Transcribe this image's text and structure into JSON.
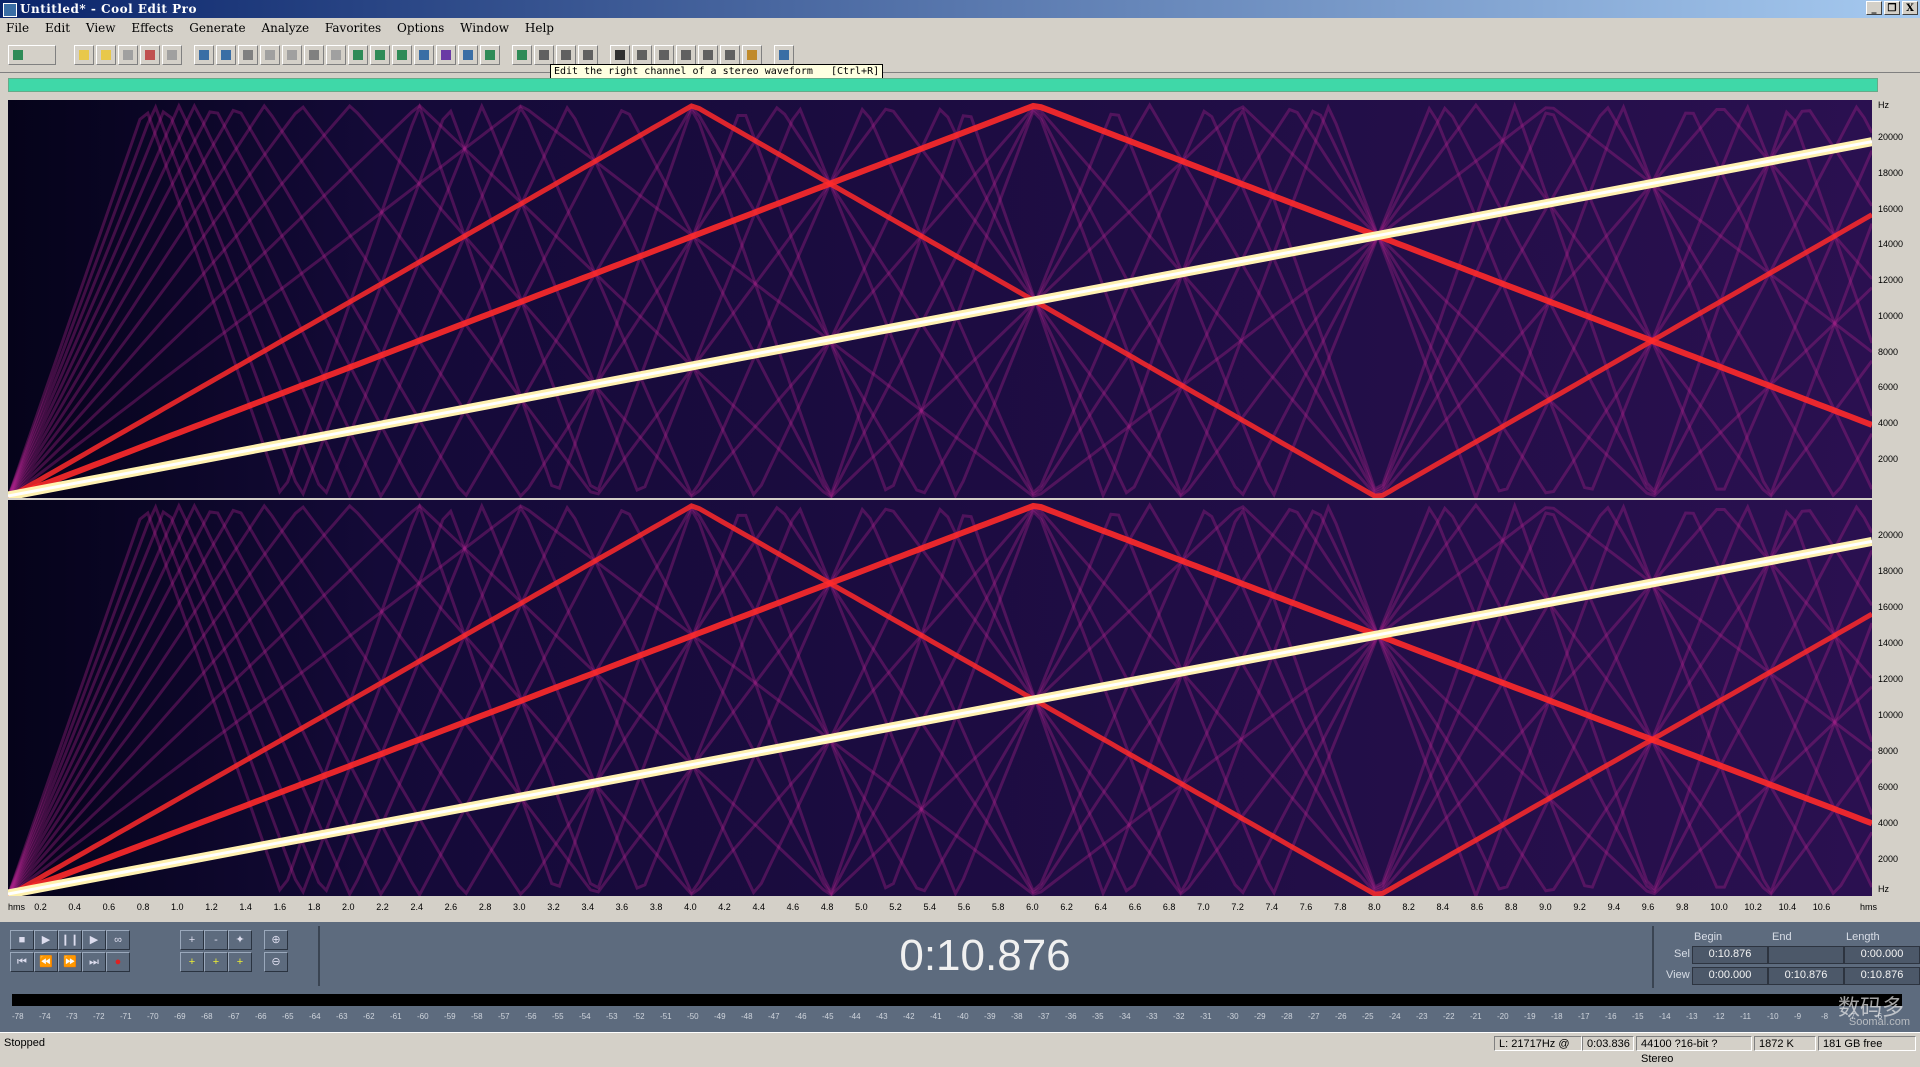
{
  "window": {
    "title": "Untitled* - Cool Edit Pro",
    "buttons": [
      "_",
      "❐",
      "X"
    ]
  },
  "menu": [
    "File",
    "Edit",
    "View",
    "Effects",
    "Generate",
    "Analyze",
    "Favorites",
    "Options",
    "Window",
    "Help"
  ],
  "toolbar": {
    "button_count": 32,
    "tooltip": "Edit the right channel of a stereo waveform   [Ctrl+R]"
  },
  "frequency_ruler": {
    "unit": "Hz",
    "ticks": [
      "20000",
      "18000",
      "16000",
      "14000",
      "12000",
      "10000",
      "8000",
      "6000",
      "4000",
      "2000"
    ],
    "bottom_unit": "Hz"
  },
  "time_ruler": {
    "start_label": "hms",
    "end_label": "hms",
    "ticks": [
      "0.2",
      "0.4",
      "0.6",
      "0.8",
      "1.0",
      "1.2",
      "1.4",
      "1.6",
      "1.8",
      "2.0",
      "2.2",
      "2.4",
      "2.6",
      "2.8",
      "3.0",
      "3.2",
      "3.4",
      "3.6",
      "3.8",
      "4.0",
      "4.2",
      "4.4",
      "4.6",
      "4.8",
      "5.0",
      "5.2",
      "5.4",
      "5.6",
      "5.8",
      "6.0",
      "6.2",
      "6.4",
      "6.6",
      "6.8",
      "7.0",
      "7.2",
      "7.4",
      "7.6",
      "7.8",
      "8.0",
      "8.2",
      "8.4",
      "8.6",
      "8.8",
      "9.0",
      "9.2",
      "9.4",
      "9.6",
      "9.8",
      "10.0",
      "10.2",
      "10.4",
      "10.6"
    ]
  },
  "transport": {
    "row1": [
      "■",
      "▶",
      "❙❙",
      "▶",
      "∞"
    ],
    "row2": [
      "⏮",
      "⏪",
      "⏩",
      "⏭",
      "●"
    ],
    "zoom_row1": [
      "+",
      "-",
      "✦",
      "⊕"
    ],
    "zoom_row2": [
      "+",
      "+",
      "+",
      "⊖"
    ]
  },
  "time_display": "0:10.876",
  "selection": {
    "headers": [
      "Begin",
      "End",
      "Length"
    ],
    "sel_label": "Sel",
    "view_label": "View",
    "sel": [
      "0:10.876",
      "",
      "0:00.000"
    ],
    "view": [
      "0:00.000",
      "0:10.876",
      "0:10.876"
    ]
  },
  "level_meter": {
    "ticks": [
      "-78",
      "-74",
      "-73",
      "-72",
      "-71",
      "-70",
      "-69",
      "-68",
      "-67",
      "-66",
      "-65",
      "-64",
      "-63",
      "-62",
      "-61",
      "-60",
      "-59",
      "-58",
      "-57",
      "-56",
      "-55",
      "-54",
      "-53",
      "-52",
      "-51",
      "-50",
      "-49",
      "-48",
      "-47",
      "-46",
      "-45",
      "-44",
      "-43",
      "-42",
      "-41",
      "-40",
      "-39",
      "-38",
      "-37",
      "-36",
      "-35",
      "-34",
      "-33",
      "-32",
      "-31",
      "-30",
      "-29",
      "-28",
      "-27",
      "-26",
      "-25",
      "-24",
      "-23",
      "-22",
      "-21",
      "-20",
      "-19",
      "-18",
      "-17",
      "-16",
      "-15",
      "-14",
      "-13",
      "-12",
      "-11",
      "-10",
      "-9",
      "-8",
      "-7",
      "-6"
    ]
  },
  "watermark": "数码多",
  "watermark_sub": "Soomal.com",
  "status": {
    "state": "Stopped",
    "cursor": "L: 21717Hz @",
    "cursor_time": "0:03.836",
    "format": "44100 ?16-bit ?Stereo",
    "size": "1872 K",
    "free": "181 GB free"
  },
  "colors": {
    "spectrogram_bg": "#05031a",
    "sweep_main": "#fff2b0",
    "sweep_harmonic": "#ff2a2a",
    "alias": "#b0238c",
    "panel": "#5d6b7e",
    "chrome": "#d4d0c8",
    "overview": "#3fd8a8"
  }
}
